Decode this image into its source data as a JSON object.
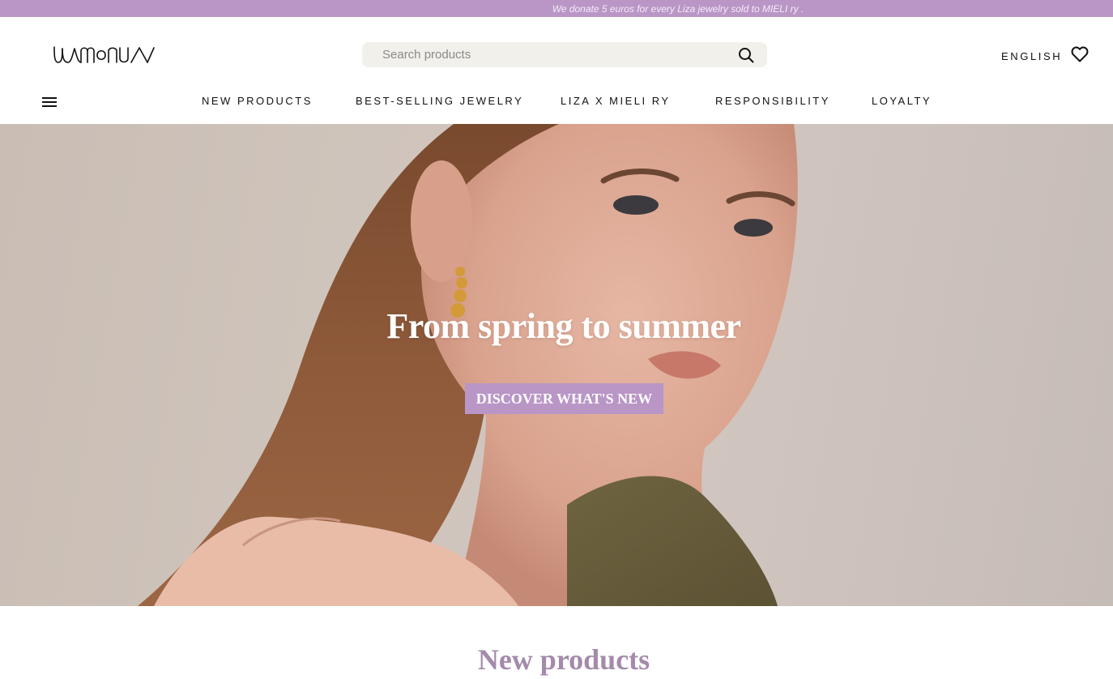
{
  "announcement": {
    "text": "We donate 5 euros for every Liza jewelry sold to MIELI ry ."
  },
  "header": {
    "brand": "LUMOANA",
    "search": {
      "placeholder": "Search products",
      "value": ""
    },
    "language": "ENGLISH",
    "icons": {
      "search": "search-icon",
      "wishlist": "heart-icon",
      "menu": "hamburger-menu-icon"
    }
  },
  "nav": {
    "items": [
      {
        "label": "NEW PRODUCTS"
      },
      {
        "label": "BEST-SELLING JEWELRY"
      },
      {
        "label": "LIZA X MIELI RY"
      },
      {
        "label": "RESPONSIBILITY"
      },
      {
        "label": "LOYALTY"
      }
    ]
  },
  "hero": {
    "title": "From spring to summer",
    "cta_label": "DISCOVER WHAT'S NEW"
  },
  "sections": {
    "new_products_title": "New products"
  },
  "colors": {
    "accent": "#b996c6",
    "announcement_text": "#f4ecf7",
    "section_title": "#a48aab",
    "search_bg": "#f2f0ea"
  }
}
